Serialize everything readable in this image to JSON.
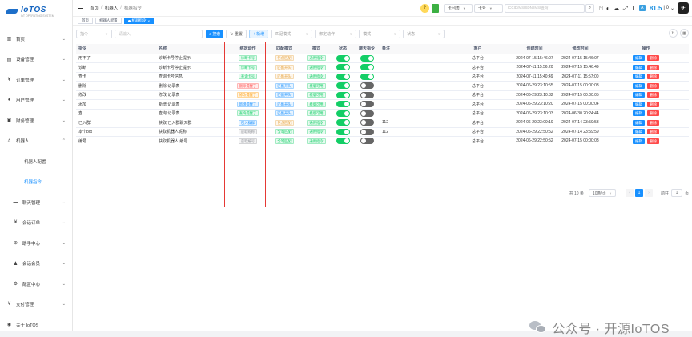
{
  "brand": {
    "name": "IoTOS",
    "subtitle": "IoT OPERATING SYSTEM"
  },
  "sidebar": {
    "items": [
      {
        "icon": "dashboard-icon",
        "glyph": "▥",
        "label": "首页",
        "arrow": "⌄"
      },
      {
        "icon": "device-icon",
        "glyph": "▤",
        "label": "设备管理",
        "arrow": "⌄"
      },
      {
        "icon": "yen-icon",
        "glyph": "¥",
        "label": "订单管理",
        "arrow": "⌄"
      },
      {
        "icon": "user-icon",
        "glyph": "●",
        "label": "用户管理",
        "arrow": "⌄"
      },
      {
        "icon": "finance-icon",
        "glyph": "▣",
        "label": "财务管理",
        "arrow": "⌄"
      },
      {
        "icon": "robot-icon",
        "glyph": "♙",
        "label": "机器人",
        "arrow": "⌃"
      },
      {
        "label": "机器人配置"
      },
      {
        "label": "机器指令"
      },
      {
        "icon": "chat-icon",
        "glyph": "▬",
        "label": "聊天管理",
        "arrow": "⌄"
      },
      {
        "icon": "yen-icon",
        "glyph": "¥",
        "label": "会话订单",
        "arrow": "⌄"
      },
      {
        "icon": "help-icon",
        "glyph": "⊕",
        "label": "助手中心",
        "arrow": "⌄"
      },
      {
        "icon": "member-icon",
        "glyph": "♟",
        "label": "会话会员",
        "arrow": "⌄"
      },
      {
        "icon": "config-icon",
        "glyph": "⚙",
        "label": "配置中心",
        "arrow": "⌄"
      },
      {
        "icon": "pay-icon",
        "glyph": "¥",
        "label": "支付管理",
        "arrow": "⌄"
      },
      {
        "icon": "info-icon",
        "glyph": "◉",
        "label": "关于 IoTOS",
        "arrow": ""
      }
    ]
  },
  "topbar": {
    "breadcrumb": [
      "首页",
      "机器人",
      "机器指令"
    ],
    "card_list_select": "卡列表",
    "card_number_select": "卡号",
    "search_placeholder": "ICCID/MSISDN/IMSI查询",
    "score": "81.5",
    "score_suffix": "| 0",
    "avatar": "✈"
  },
  "tabs": [
    {
      "label": "首页",
      "active": false
    },
    {
      "label": "机器人配置",
      "active": false
    },
    {
      "label": "机器指令",
      "active": true
    }
  ],
  "filters": {
    "command_select": "指令",
    "command_placeholder": "请输入",
    "search_btn": "搜索",
    "reset_btn": "重置",
    "add_btn": "+ 新增",
    "match_mode_select": "匹配模式",
    "action_select": "绑定动作",
    "mode_select": "模式",
    "status_select": "状态"
  },
  "table": {
    "headers": [
      "指令",
      "名称",
      "绑定动作",
      "匹配模式",
      "模式",
      "状态",
      "聊天指令",
      "备注",
      "客户",
      "创建时间",
      "修改时间",
      "操作"
    ],
    "rows": [
      {
        "cmd": "用不了",
        "name": "诊断卡号停止提示",
        "action": "诊断卡号",
        "action_color": "green",
        "match": "包含匹配",
        "match_color": "yellow",
        "mode": "通用指令",
        "mode_color": "green",
        "status": true,
        "chat": true,
        "note": "",
        "customer": "总平台",
        "created": "2024-07-15 15:46:07",
        "updated": "2024-07-15 15:46:07"
      },
      {
        "cmd": "诊断",
        "name": "诊断卡号停止提示",
        "action": "诊断卡号",
        "action_color": "green",
        "match": "匹配开头",
        "match_color": "yellow",
        "mode": "通用指令",
        "mode_color": "green",
        "status": true,
        "chat": true,
        "note": "",
        "customer": "总平台",
        "created": "2024-07-11 15:56:20",
        "updated": "2024-07-15 15:46:49"
      },
      {
        "cmd": "查卡",
        "name": "查询卡号信息",
        "action": "查询卡号",
        "action_color": "green",
        "match": "匹配开头",
        "match_color": "yellow",
        "mode": "通用指令",
        "mode_color": "green",
        "status": true,
        "chat": true,
        "note": "",
        "customer": "总平台",
        "created": "2024-07-11 15:40:49",
        "updated": "2024-07-11 15:57:00"
      },
      {
        "cmd": "删除",
        "name": "删除 记录表",
        "action": "删除提醒了",
        "action_color": "red",
        "match": "匹配开头",
        "match_color": "blue",
        "mode": "模版可用",
        "mode_color": "green",
        "status": true,
        "chat": false,
        "note": "",
        "customer": "总平台",
        "created": "2024-06-29 23:10:55",
        "updated": "2024-07-15 00:00:03"
      },
      {
        "cmd": "修改",
        "name": "修改 记录表",
        "action": "修改提醒了",
        "action_color": "orange",
        "match": "匹配开头",
        "match_color": "blue",
        "mode": "模版可用",
        "mode_color": "green",
        "status": true,
        "chat": false,
        "note": "",
        "customer": "总平台",
        "created": "2024-06-29 23:10:32",
        "updated": "2024-07-15 00:00:05"
      },
      {
        "cmd": "添加",
        "name": "新增 记录表",
        "action": "新增提醒了",
        "action_color": "blue",
        "match": "匹配开头",
        "match_color": "blue",
        "mode": "模版可用",
        "mode_color": "green",
        "status": true,
        "chat": false,
        "note": "",
        "customer": "总平台",
        "created": "2024-06-29 23:10:20",
        "updated": "2024-07-15 00:00:04"
      },
      {
        "cmd": "查",
        "name": "查询 记录表",
        "action": "查询提醒了",
        "action_color": "green",
        "match": "匹配开头",
        "match_color": "blue",
        "mode": "模版可用",
        "mode_color": "green",
        "status": true,
        "chat": false,
        "note": "",
        "customer": "总平台",
        "created": "2024-06-29 23:10:03",
        "updated": "2024-06-30 20:24:44"
      },
      {
        "cmd": "已入群",
        "name": "获取 已入群聊天群",
        "action": "已入群群",
        "action_color": "blue",
        "match": "包含匹配",
        "match_color": "yellow",
        "mode": "通用指令",
        "mode_color": "green",
        "status": true,
        "chat": false,
        "note": "112",
        "customer": "总平台",
        "created": "2024-06-29 23:09:19",
        "updated": "2024-07-14 23:59:53"
      },
      {
        "cmd": "本个bot",
        "name": "获取机器人昵称",
        "action": "获取昵称",
        "action_color": "gray",
        "match": "全等匹配",
        "match_color": "green",
        "mode": "通用指令",
        "mode_color": "green",
        "status": true,
        "chat": false,
        "note": "112",
        "customer": "总平台",
        "created": "2024-06-29 22:50:52",
        "updated": "2024-07-14 23:59:59"
      },
      {
        "cmd": "编号",
        "name": "获取机器人 编号",
        "action": "获取编号",
        "action_color": "gray",
        "match": "全等匹配",
        "match_color": "green",
        "mode": "通用指令",
        "mode_color": "green",
        "status": true,
        "chat": false,
        "note": "",
        "customer": "总平台",
        "created": "2024-06-29 22:50:52",
        "updated": "2024-07-15 00:00:03"
      }
    ],
    "edit_label": "编辑",
    "delete_label": "删除"
  },
  "pagination": {
    "total": "共 10 条",
    "page_size": "10条/页",
    "prev": "‹",
    "current": "1",
    "next": "›",
    "goto_label": "前往",
    "goto_value": "1",
    "goto_suffix": "页"
  },
  "watermark": "公众号 · 开源IoTOS"
}
